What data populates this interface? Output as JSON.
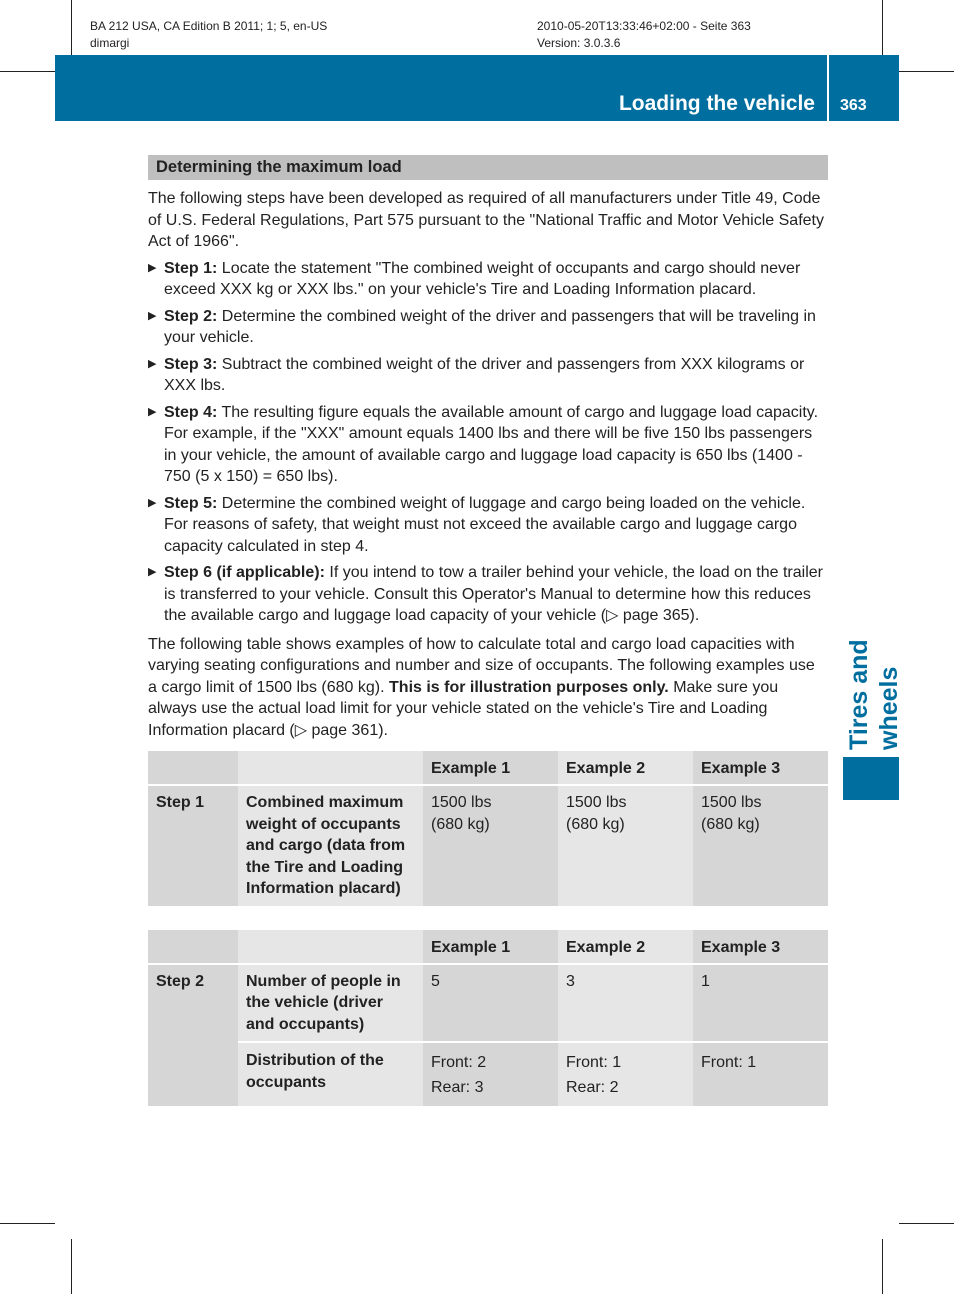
{
  "meta": {
    "edition": "BA 212 USA, CA Edition B 2011; 1; 5, en-US",
    "author": "dimargi",
    "timestamp": "2010-05-20T13:33:46+02:00 - Seite 363",
    "version": "Version: 3.0.3.6"
  },
  "header": {
    "title": "Loading the vehicle",
    "page_number": "363",
    "chapter_tab": "Tires and wheels",
    "accent_color": "#006e9e"
  },
  "section": {
    "heading": "Determining the maximum load",
    "intro": "The following steps have been developed as required of all manufacturers under Title 49, Code of U.S. Federal Regulations, Part 575 pursuant to the \"National Traffic and Motor Vehicle Safety Act of 1966\".",
    "steps": [
      {
        "label": "Step 1:",
        "text": " Locate the statement \"The combined weight of occupants and cargo should never exceed XXX kg or XXX lbs.\" on your vehicle's Tire and Loading Information placard."
      },
      {
        "label": "Step 2:",
        "text": " Determine the combined weight of the driver and passengers that will be traveling in your vehicle."
      },
      {
        "label": "Step 3:",
        "text": " Subtract the combined weight of the driver and passengers from XXX kilograms or XXX lbs."
      },
      {
        "label": "Step 4:",
        "text": " The resulting figure equals the available amount of cargo and luggage load capacity. For example, if the \"XXX\" amount equals 1400 lbs and there will be five 150 lbs passengers in your vehicle, the amount of available cargo and luggage load capacity is 650 lbs (1400 - 750 (5 x 150) = 650 lbs)."
      },
      {
        "label": "Step 5:",
        "text": " Determine the combined weight of luggage and cargo being loaded on the vehicle. For reasons of safety, that weight must not exceed the available cargo and luggage cargo capacity calculated in step 4."
      },
      {
        "label": "Step 6 (if applicable):",
        "text": " If you intend to tow a trailer behind your vehicle, the load on the trailer is transferred to your vehicle. Consult this Operator's Manual to determine how this reduces the available cargo and luggage load capacity of your vehicle (▷ page 365)."
      }
    ],
    "para2_a": "The following table shows examples of how to calculate total and cargo load capacities with varying seating configurations and number and size of occupants. The following examples use a cargo limit of 1500 lbs (680 kg). ",
    "para2_bold": "This is for illustration purposes only.",
    "para2_b": " Make sure you always use the actual load limit for your vehicle stated on the vehicle's Tire and Loading Information placard (▷ page 361)."
  },
  "table1": {
    "headers": [
      "",
      "",
      "Example 1",
      "Example 2",
      "Example 3"
    ],
    "step": "Step 1",
    "label": "Combined maximum weight of occupants and cargo (data from the Tire and Loading Information placard)",
    "values": [
      {
        "line1": "1500 lbs",
        "line2": "(680 kg)"
      },
      {
        "line1": "1500 lbs",
        "line2": "(680 kg)"
      },
      {
        "line1": "1500 lbs",
        "line2": "(680 kg)"
      }
    ]
  },
  "table2": {
    "headers": [
      "",
      "",
      "Example 1",
      "Example 2",
      "Example 3"
    ],
    "step": "Step 2",
    "rows": [
      {
        "label": "Number of people in the vehicle (driver and occupants)",
        "values": [
          {
            "line1": "5",
            "line2": ""
          },
          {
            "line1": "3",
            "line2": ""
          },
          {
            "line1": "1",
            "line2": ""
          }
        ]
      },
      {
        "label": "Distribution of the occupants",
        "values": [
          {
            "line1": "Front: 2",
            "line2": "Rear: 3"
          },
          {
            "line1": "Front: 1",
            "line2": "Rear: 2"
          },
          {
            "line1": "Front: 1",
            "line2": ""
          }
        ]
      }
    ]
  }
}
